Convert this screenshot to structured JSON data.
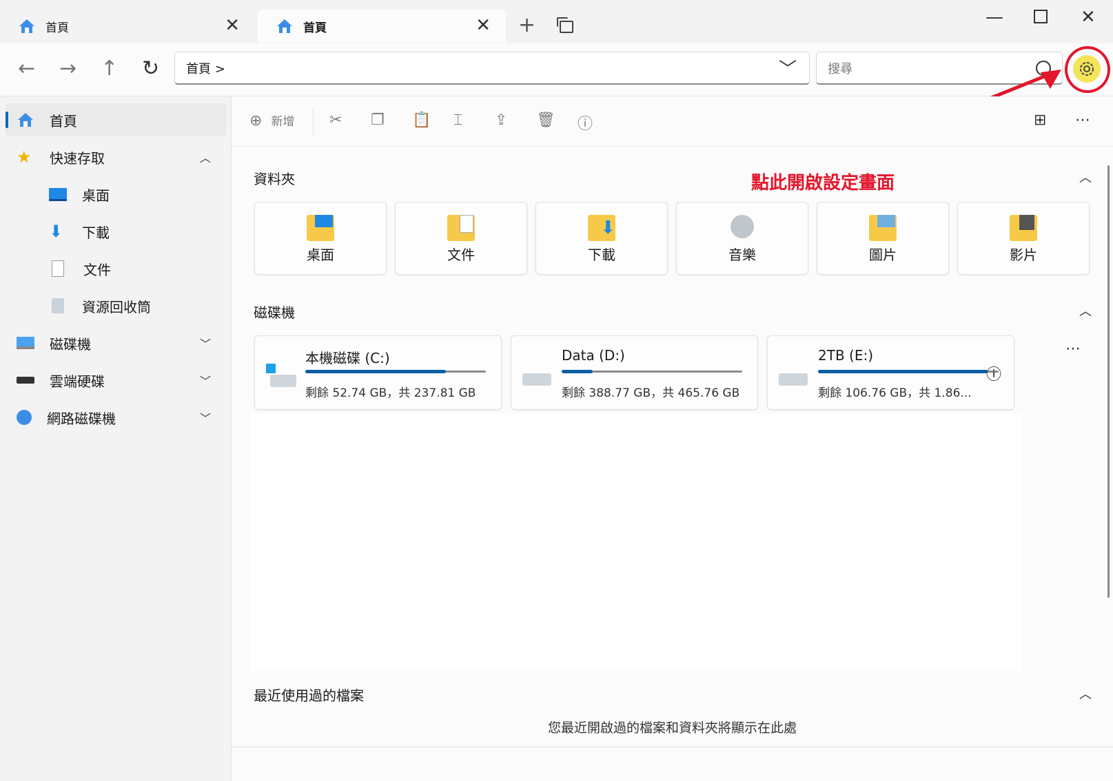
{
  "tabs": [
    {
      "label": "首頁"
    },
    {
      "label": "首頁"
    }
  ],
  "address": {
    "path": "首頁 >"
  },
  "search": {
    "placeholder": "搜尋"
  },
  "sidebar": {
    "items": [
      {
        "label": "首頁"
      },
      {
        "label": "快速存取"
      },
      {
        "label": "桌面"
      },
      {
        "label": "下載"
      },
      {
        "label": "文件"
      },
      {
        "label": "資源回收筒"
      },
      {
        "label": "磁碟機"
      },
      {
        "label": "雲端硬碟"
      },
      {
        "label": "網路磁碟機"
      }
    ]
  },
  "toolbar": {
    "new_label": "新增"
  },
  "sections": {
    "folders_title": "資料夾",
    "drives_title": "磁碟機",
    "recent_title": "最近使用過的檔案",
    "recent_empty": "您最近開啟過的檔案和資料夾將顯示在此處"
  },
  "folders": [
    {
      "label": "桌面"
    },
    {
      "label": "文件"
    },
    {
      "label": "下載"
    },
    {
      "label": "音樂"
    },
    {
      "label": "圖片"
    },
    {
      "label": "影片"
    }
  ],
  "drives": [
    {
      "name": "本機磁碟 (C:)",
      "free": "剩餘 52.74 GB，共 237.81 GB",
      "used_fraction": 0.78
    },
    {
      "name": "Data (D:)",
      "free": "剩餘 388.77 GB，共 465.76 GB",
      "used_fraction": 0.17
    },
    {
      "name": "2TB (E:)",
      "free": "剩餘 106.76 GB，共 1.86...",
      "used_fraction": 0.94
    }
  ],
  "annotation": {
    "text": "點此開啟設定畫面"
  },
  "colors": {
    "accent": "#0067c0",
    "annotation": "#e3162b",
    "highlight": "#f4e45a"
  }
}
